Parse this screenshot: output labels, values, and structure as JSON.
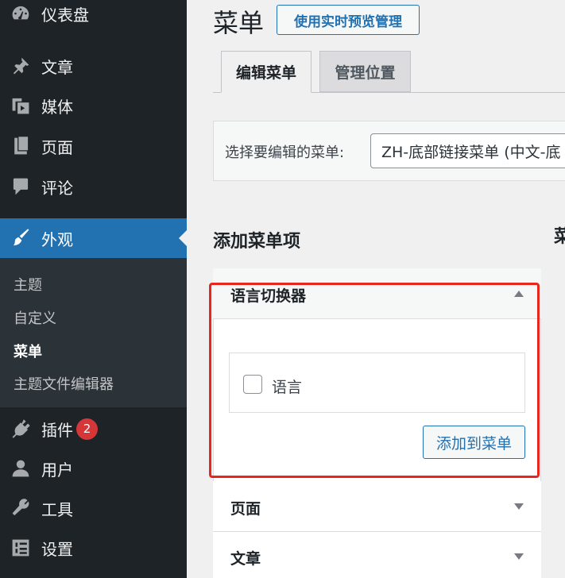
{
  "sidebar": {
    "items": [
      {
        "label": "仪表盘",
        "icon": "dashboard-icon"
      },
      {
        "label": "文章",
        "icon": "pin-icon"
      },
      {
        "label": "媒体",
        "icon": "media-icon"
      },
      {
        "label": "页面",
        "icon": "page-icon"
      },
      {
        "label": "评论",
        "icon": "comment-icon"
      },
      {
        "label": "外观",
        "icon": "brush-icon"
      },
      {
        "label": "插件",
        "icon": "plugin-icon"
      },
      {
        "label": "用户",
        "icon": "user-icon"
      },
      {
        "label": "工具",
        "icon": "wrench-icon"
      },
      {
        "label": "设置",
        "icon": "settings-icon"
      }
    ],
    "submenu": [
      "主题",
      "自定义",
      "菜单",
      "主题文件编辑器"
    ],
    "plugin_badge": "2"
  },
  "header": {
    "title": "菜单",
    "live_preview_button": "使用实时预览管理"
  },
  "tabs": [
    {
      "label": "编辑菜单"
    },
    {
      "label": "管理位置"
    }
  ],
  "menu_select": {
    "label": "选择要编辑的菜单:",
    "value": "ZH-底部链接菜单 (中文-底"
  },
  "add_items": {
    "heading": "添加菜单项",
    "right_heading_fragment": "菜",
    "sections": [
      {
        "title": "语言切换器"
      },
      {
        "title": "页面"
      },
      {
        "title": "文章"
      }
    ],
    "checkbox_label": "语言",
    "add_button": "添加到菜单"
  },
  "colors": {
    "sidebar_bg": "#1d2327",
    "accent": "#2271b1",
    "badge": "#d63638",
    "highlight": "#e8261e"
  }
}
